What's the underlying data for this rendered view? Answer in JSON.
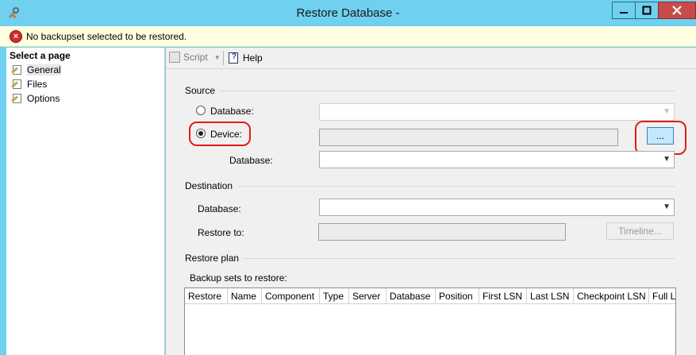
{
  "window": {
    "title": "Restore Database -",
    "app_icon": "tools-wrench-icon",
    "controls": {
      "minimize": "minimize-icon",
      "maximize": "maximize-icon",
      "close": "close-icon"
    }
  },
  "error_bar": {
    "icon": "error-x-icon",
    "message": "No backupset selected to be restored."
  },
  "sidebar": {
    "header": "Select a page",
    "items": [
      {
        "label": "General",
        "icon": "page-wrench-icon",
        "selected": true
      },
      {
        "label": "Files",
        "icon": "page-wrench-icon",
        "selected": false
      },
      {
        "label": "Options",
        "icon": "page-wrench-icon",
        "selected": false
      }
    ]
  },
  "toolbar": {
    "script_label": "Script",
    "help_label": "Help"
  },
  "source": {
    "heading": "Source",
    "database_radio_label": "Database:",
    "device_radio_label": "Device:",
    "selected": "device",
    "device_value": "",
    "browse_label": "...",
    "database_label": "Database:",
    "database_value": ""
  },
  "destination": {
    "heading": "Destination",
    "database_label": "Database:",
    "database_value": "",
    "restore_to_label": "Restore to:",
    "restore_to_value": "",
    "timeline_label": "Timeline..."
  },
  "restore_plan": {
    "heading": "Restore plan",
    "backup_sets_label": "Backup sets to restore:",
    "columns": [
      "Restore",
      "Name",
      "Component",
      "Type",
      "Server",
      "Database",
      "Position",
      "First LSN",
      "Last LSN",
      "Checkpoint LSN",
      "Full LSN"
    ]
  },
  "colors": {
    "title_bar": "#6fd0ef",
    "close_button": "#c74b4b",
    "error_bar": "#ffffe1",
    "error_icon": "#d32b2b",
    "highlight": "#e21b1b",
    "browse_button": "#c4e8fb"
  }
}
